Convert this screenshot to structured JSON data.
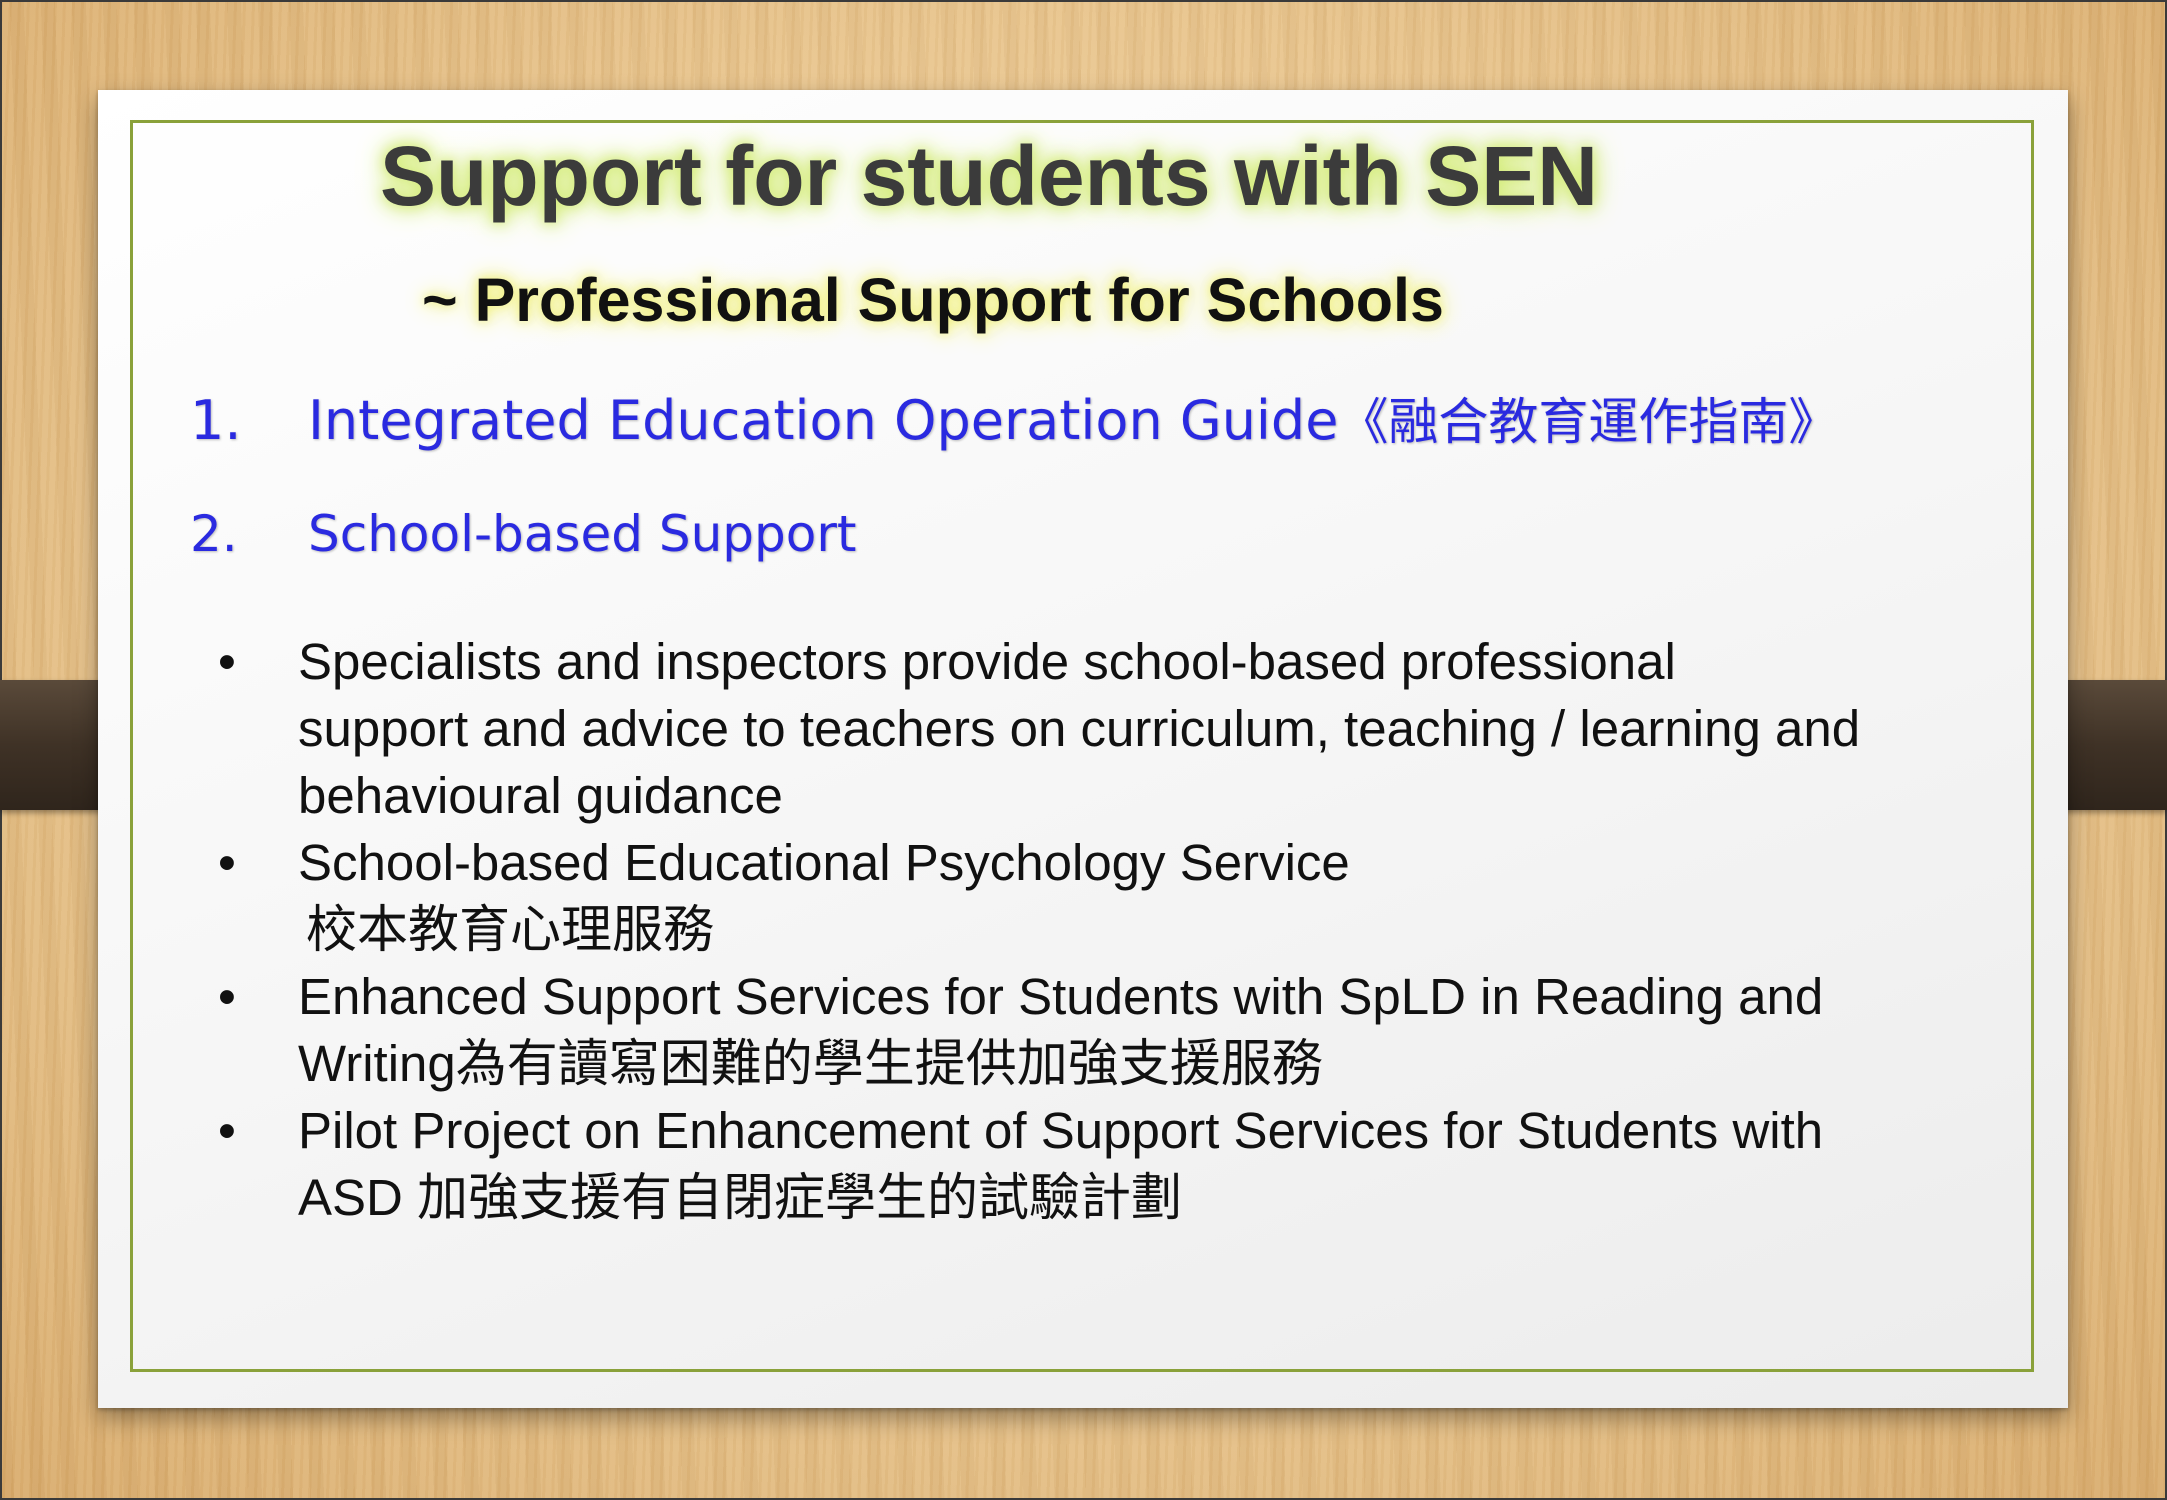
{
  "slide": {
    "title": "Support for students with SEN",
    "subtitle": "~ Professional Support for Schools",
    "numbered_items": [
      {
        "number": "1.",
        "text": "Integrated Education Operation Guide",
        "cjk": "《融合教育運作指南》"
      },
      {
        "number": "2.",
        "text": "School-based Support"
      }
    ],
    "bullet_symbol": "•",
    "bullets": [
      {
        "lines": [
          "Specialists and inspectors provide school-based professional",
          "support and advice to teachers on curriculum, teaching / learning and",
          "behavioural guidance"
        ]
      },
      {
        "lines": [
          "School-based Educational Psychology Service",
          "校本教育心理服務"
        ]
      },
      {
        "lines": [
          "Enhanced Support Services for Students with SpLD in Reading and",
          "Writing為有讀寫困難的學生提供加強支援服務"
        ]
      },
      {
        "lines": [
          "Pilot Project on Enhancement of Support Services for Students with",
          "ASD 加強支援有自閉症學生的試驗計劃"
        ]
      }
    ]
  },
  "colors": {
    "title_glow": "#d4ec7a",
    "subtitle_glow": "#f0f07a",
    "numbered_text": "#2a2ae0",
    "frame_border": "#8aa13a",
    "strap": "#3f3226"
  }
}
